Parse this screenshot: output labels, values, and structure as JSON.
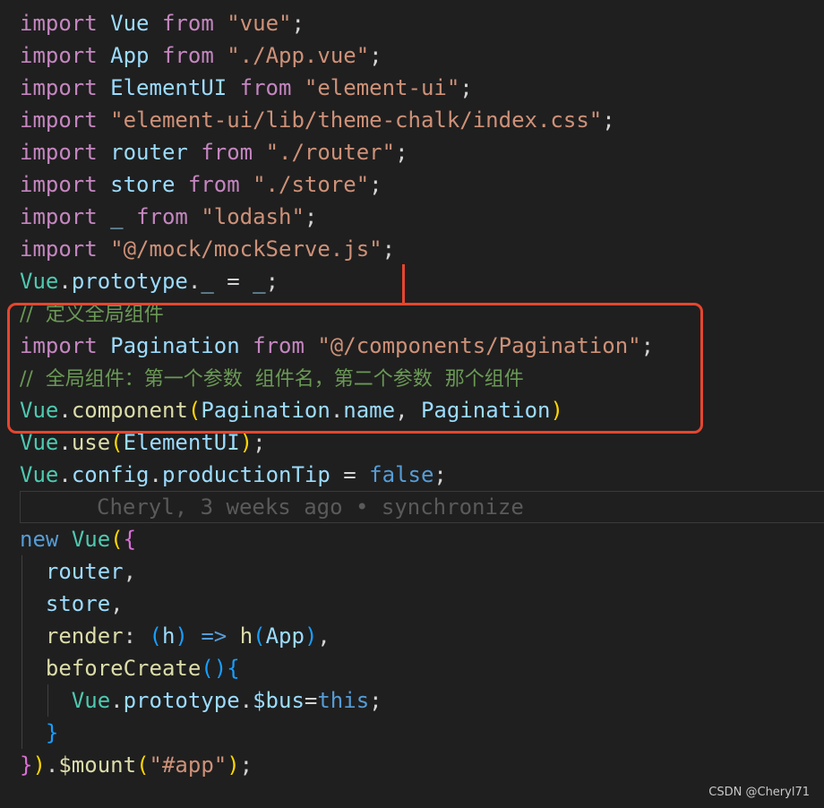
{
  "lines": [
    {
      "tokens": [
        {
          "text": "import",
          "c": "key"
        },
        {
          "text": " "
        },
        {
          "text": "Vue",
          "c": "var"
        },
        {
          "text": " "
        },
        {
          "text": "from",
          "c": "key"
        },
        {
          "text": " "
        },
        {
          "text": "\"vue\"",
          "c": "str"
        },
        {
          "text": ";"
        }
      ]
    },
    {
      "tokens": [
        {
          "text": "import",
          "c": "key"
        },
        {
          "text": " "
        },
        {
          "text": "App",
          "c": "var"
        },
        {
          "text": " "
        },
        {
          "text": "from",
          "c": "key"
        },
        {
          "text": " "
        },
        {
          "text": "\"./App.vue\"",
          "c": "str"
        },
        {
          "text": ";"
        }
      ]
    },
    {
      "tokens": [
        {
          "text": "import",
          "c": "key"
        },
        {
          "text": " "
        },
        {
          "text": "ElementUI",
          "c": "var"
        },
        {
          "text": " "
        },
        {
          "text": "from",
          "c": "key"
        },
        {
          "text": " "
        },
        {
          "text": "\"element-ui\"",
          "c": "str"
        },
        {
          "text": ";"
        }
      ]
    },
    {
      "tokens": [
        {
          "text": "import",
          "c": "key"
        },
        {
          "text": " "
        },
        {
          "text": "\"element-ui/lib/theme-chalk/index.css\"",
          "c": "str"
        },
        {
          "text": ";"
        }
      ]
    },
    {
      "tokens": [
        {
          "text": "import",
          "c": "key"
        },
        {
          "text": " "
        },
        {
          "text": "router",
          "c": "var"
        },
        {
          "text": " "
        },
        {
          "text": "from",
          "c": "key"
        },
        {
          "text": " "
        },
        {
          "text": "\"./router\"",
          "c": "str"
        },
        {
          "text": ";"
        }
      ]
    },
    {
      "tokens": [
        {
          "text": "import",
          "c": "key"
        },
        {
          "text": " "
        },
        {
          "text": "store",
          "c": "var"
        },
        {
          "text": " "
        },
        {
          "text": "from",
          "c": "key"
        },
        {
          "text": " "
        },
        {
          "text": "\"./store\"",
          "c": "str"
        },
        {
          "text": ";"
        }
      ]
    },
    {
      "tokens": [
        {
          "text": "import",
          "c": "key"
        },
        {
          "text": " "
        },
        {
          "text": "_",
          "c": "var"
        },
        {
          "text": " "
        },
        {
          "text": "from",
          "c": "key"
        },
        {
          "text": " "
        },
        {
          "text": "\"lodash\"",
          "c": "str"
        },
        {
          "text": ";"
        }
      ]
    },
    {
      "tokens": [
        {
          "text": "import",
          "c": "key"
        },
        {
          "text": " "
        },
        {
          "text": "\"@/mock/mockServe.js\"",
          "c": "str"
        },
        {
          "text": ";"
        }
      ]
    },
    {
      "tokens": [
        {
          "text": "Vue",
          "c": "cls"
        },
        {
          "text": "."
        },
        {
          "text": "prototype",
          "c": "var"
        },
        {
          "text": "."
        },
        {
          "text": "_",
          "c": "var"
        },
        {
          "text": " = "
        },
        {
          "text": "_",
          "c": "var"
        },
        {
          "text": ";"
        }
      ]
    },
    {
      "tokens": [
        {
          "text": "//  定义全局组件",
          "c": "cmt"
        }
      ]
    },
    {
      "tokens": [
        {
          "text": "import",
          "c": "key"
        },
        {
          "text": " "
        },
        {
          "text": "Pagination",
          "c": "var"
        },
        {
          "text": " "
        },
        {
          "text": "from",
          "c": "key"
        },
        {
          "text": " "
        },
        {
          "text": "\"@/components/Pagination\"",
          "c": "str"
        },
        {
          "text": ";"
        }
      ]
    },
    {
      "tokens": [
        {
          "text": "//  全局组件：第一个参数  组件名，第二个参数  那个组件",
          "c": "cmt"
        }
      ]
    },
    {
      "tokens": [
        {
          "text": "Vue",
          "c": "cls"
        },
        {
          "text": "."
        },
        {
          "text": "component",
          "c": "fn"
        },
        {
          "text": "(",
          "c": "br1"
        },
        {
          "text": "Pagination",
          "c": "var"
        },
        {
          "text": "."
        },
        {
          "text": "name",
          "c": "var"
        },
        {
          "text": ", "
        },
        {
          "text": "Pagination",
          "c": "var"
        },
        {
          "text": ")",
          "c": "br1"
        }
      ]
    },
    {
      "tokens": [
        {
          "text": "Vue",
          "c": "cls"
        },
        {
          "text": "."
        },
        {
          "text": "use",
          "c": "fn"
        },
        {
          "text": "(",
          "c": "br1"
        },
        {
          "text": "ElementUI",
          "c": "var"
        },
        {
          "text": ")",
          "c": "br1"
        },
        {
          "text": ";"
        }
      ]
    },
    {
      "tokens": [
        {
          "text": "Vue",
          "c": "cls"
        },
        {
          "text": "."
        },
        {
          "text": "config",
          "c": "var"
        },
        {
          "text": "."
        },
        {
          "text": "productionTip",
          "c": "var"
        },
        {
          "text": " = "
        },
        {
          "text": "false",
          "c": "blue"
        },
        {
          "text": ";"
        }
      ]
    },
    {
      "tokens": []
    },
    {
      "tokens": [
        {
          "text": "new",
          "c": "blue"
        },
        {
          "text": " "
        },
        {
          "text": "Vue",
          "c": "cls"
        },
        {
          "text": "(",
          "c": "br1"
        },
        {
          "text": "{",
          "c": "br2"
        }
      ]
    },
    {
      "tokens": [
        {
          "text": "  "
        },
        {
          "text": "router",
          "c": "var"
        },
        {
          "text": ","
        }
      ]
    },
    {
      "tokens": [
        {
          "text": "  "
        },
        {
          "text": "store",
          "c": "var"
        },
        {
          "text": ","
        }
      ]
    },
    {
      "tokens": [
        {
          "text": "  "
        },
        {
          "text": "render",
          "c": "fn"
        },
        {
          "text": ": "
        },
        {
          "text": "(",
          "c": "br3"
        },
        {
          "text": "h",
          "c": "var"
        },
        {
          "text": ")",
          "c": "br3"
        },
        {
          "text": " "
        },
        {
          "text": "=>",
          "c": "blue"
        },
        {
          "text": " "
        },
        {
          "text": "h",
          "c": "fn"
        },
        {
          "text": "(",
          "c": "br3"
        },
        {
          "text": "App",
          "c": "var"
        },
        {
          "text": ")",
          "c": "br3"
        },
        {
          "text": ","
        }
      ]
    },
    {
      "tokens": [
        {
          "text": "  "
        },
        {
          "text": "beforeCreate",
          "c": "fn"
        },
        {
          "text": "(",
          "c": "br3"
        },
        {
          "text": ")",
          "c": "br3"
        },
        {
          "text": "{",
          "c": "br3"
        }
      ]
    },
    {
      "tokens": [
        {
          "text": "    "
        },
        {
          "text": "Vue",
          "c": "cls"
        },
        {
          "text": "."
        },
        {
          "text": "prototype",
          "c": "var"
        },
        {
          "text": "."
        },
        {
          "text": "$bus",
          "c": "var"
        },
        {
          "text": "="
        },
        {
          "text": "this",
          "c": "blue"
        },
        {
          "text": ";"
        }
      ]
    },
    {
      "tokens": [
        {
          "text": "  "
        },
        {
          "text": "}",
          "c": "br3"
        }
      ]
    },
    {
      "tokens": [
        {
          "text": "}",
          "c": "br2"
        },
        {
          "text": ")",
          "c": "br1"
        },
        {
          "text": "."
        },
        {
          "text": "$mount",
          "c": "fn"
        },
        {
          "text": "(",
          "c": "br1"
        },
        {
          "text": "\"#app\"",
          "c": "str"
        },
        {
          "text": ")",
          "c": "br1"
        },
        {
          "text": ";"
        }
      ]
    }
  ],
  "blame": {
    "text": "Cheryl, 3 weeks ago • synchronize"
  },
  "watermark": "CSDN @Cheryl71"
}
